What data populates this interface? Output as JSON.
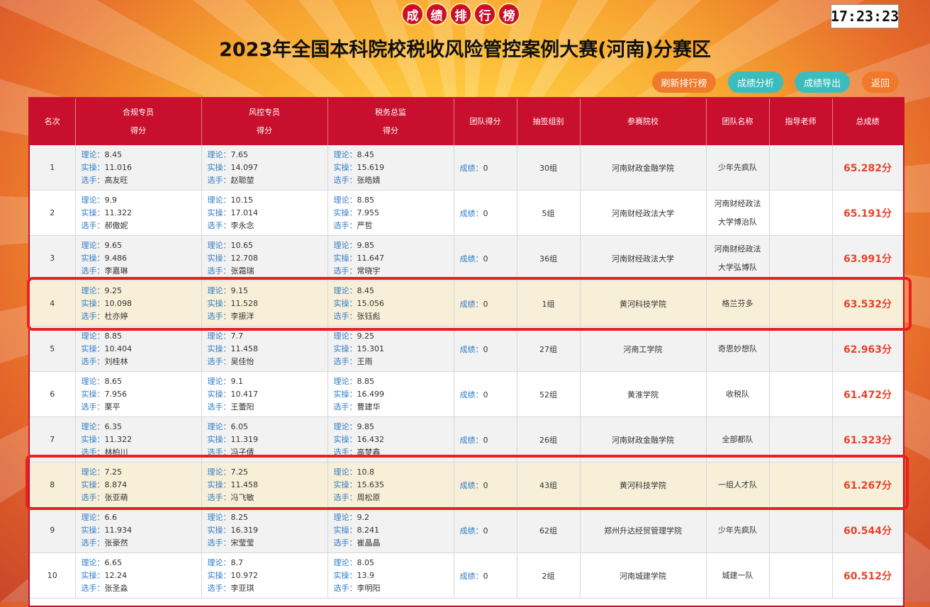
{
  "header": {
    "badge_chars": [
      "成",
      "绩",
      "排",
      "行",
      "榜"
    ],
    "clock": "17:23:23",
    "title": "2023年全国本科院校税收风险管控案例大赛(河南)分赛区"
  },
  "buttons": {
    "refresh": "刷新排行榜",
    "analysis": "成绩分析",
    "export": "成绩导出",
    "back": "返回"
  },
  "table": {
    "headers": {
      "rank": "名次",
      "compliance": "合规专员",
      "risk": "风控专员",
      "tax": "税务总监",
      "score_sub": "得分",
      "team_score": "团队得分",
      "group": "抽签组别",
      "school": "参赛院校",
      "team_name": "团队名称",
      "teacher": "指导老师",
      "total": "总成绩"
    },
    "labels": {
      "theory": "理论：",
      "practice": "实操：",
      "player": "选手：",
      "result": "成绩："
    },
    "rows": [
      {
        "rank": "1",
        "c": {
          "t": "8.45",
          "p": "11.016",
          "n": "高友旺"
        },
        "r": {
          "t": "7.65",
          "p": "14.097",
          "n": "赵聪堃"
        },
        "x": {
          "t": "8.45",
          "p": "15.619",
          "n": "张皓婧"
        },
        "team_score": "0",
        "group": "30组",
        "school": "河南财政金融学院",
        "team": "少年先疯队",
        "teacher": "",
        "total": "65.282分"
      },
      {
        "rank": "2",
        "c": {
          "t": "9.9",
          "p": "11.322",
          "n": "郝傲妮"
        },
        "r": {
          "t": "10.15",
          "p": "17.014",
          "n": "李永念"
        },
        "x": {
          "t": "8.85",
          "p": "7.955",
          "n": "严哲"
        },
        "team_score": "0",
        "group": "5组",
        "school": "河南财经政法大学",
        "team": "河南财经政法大学博治队",
        "teacher": "",
        "total": "65.191分"
      },
      {
        "rank": "3",
        "c": {
          "t": "9.65",
          "p": "9.486",
          "n": "李嘉琳"
        },
        "r": {
          "t": "10.65",
          "p": "12.708",
          "n": "张霜瑞"
        },
        "x": {
          "t": "9.85",
          "p": "11.647",
          "n": "常晓宇"
        },
        "team_score": "0",
        "group": "36组",
        "school": "河南财经政法大学",
        "team": "河南财经政法大学弘博队",
        "teacher": "",
        "total": "63.991分"
      },
      {
        "rank": "4",
        "c": {
          "t": "9.25",
          "p": "10.098",
          "n": "杜亦婷"
        },
        "r": {
          "t": "9.15",
          "p": "11.528",
          "n": "李振洋"
        },
        "x": {
          "t": "8.45",
          "p": "15.056",
          "n": "张钰彪"
        },
        "team_score": "0",
        "group": "1组",
        "school": "黄河科技学院",
        "team": "格兰芬多",
        "teacher": "",
        "total": "63.532分"
      },
      {
        "rank": "5",
        "c": {
          "t": "8.85",
          "p": "10.404",
          "n": "刘桂林"
        },
        "r": {
          "t": "7.7",
          "p": "11.458",
          "n": "吴佳怡"
        },
        "x": {
          "t": "9.25",
          "p": "15.301",
          "n": "王雨"
        },
        "team_score": "0",
        "group": "27组",
        "school": "河南工学院",
        "team": "奇思妙想队",
        "teacher": "",
        "total": "62.963分"
      },
      {
        "rank": "6",
        "c": {
          "t": "8.65",
          "p": "7.956",
          "n": "栗平"
        },
        "r": {
          "t": "9.1",
          "p": "10.417",
          "n": "王蕾阳"
        },
        "x": {
          "t": "8.85",
          "p": "16.499",
          "n": "曹建华"
        },
        "team_score": "0",
        "group": "52组",
        "school": "黄淮学院",
        "team": "收税队",
        "teacher": "",
        "total": "61.472分"
      },
      {
        "rank": "7",
        "c": {
          "t": "6.35",
          "p": "11.322",
          "n": "林柏川"
        },
        "r": {
          "t": "6.05",
          "p": "11.319",
          "n": "冯子倩"
        },
        "x": {
          "t": "9.85",
          "p": "16.432",
          "n": "高梦鑫"
        },
        "team_score": "0",
        "group": "26组",
        "school": "河南财政金融学院",
        "team": "全部都队",
        "teacher": "",
        "total": "61.323分"
      },
      {
        "rank": "8",
        "c": {
          "t": "7.25",
          "p": "8.874",
          "n": "张亚萌"
        },
        "r": {
          "t": "7.25",
          "p": "11.458",
          "n": "冯飞敏"
        },
        "x": {
          "t": "10.8",
          "p": "15.635",
          "n": "周松原"
        },
        "team_score": "0",
        "group": "43组",
        "school": "黄河科技学院",
        "team": "一组人才队",
        "teacher": "",
        "total": "61.267分"
      },
      {
        "rank": "9",
        "c": {
          "t": "6.6",
          "p": "11.934",
          "n": "张豪然"
        },
        "r": {
          "t": "8.25",
          "p": "16.319",
          "n": "宋莹莹"
        },
        "x": {
          "t": "9.2",
          "p": "8.241",
          "n": "崔晶晶"
        },
        "team_score": "0",
        "group": "62组",
        "school": "郑州升达经贸管理学院",
        "team": "少年先疯队",
        "teacher": "",
        "total": "60.544分"
      },
      {
        "rank": "10",
        "c": {
          "t": "6.65",
          "p": "12.24",
          "n": "张圣淼"
        },
        "r": {
          "t": "8.7",
          "p": "10.972",
          "n": "李亚琪"
        },
        "x": {
          "t": "8.05",
          "p": "13.9",
          "n": "李明阳"
        },
        "team_score": "0",
        "group": "2组",
        "school": "河南城建学院",
        "team": "城建一队",
        "teacher": "",
        "total": "60.512分"
      }
    ],
    "highlighted_ranks": [
      "4",
      "8"
    ]
  },
  "colors": {
    "header_red": "#c8102e",
    "total_red": "#e8432a",
    "label_blue": "#2f7dc6",
    "btn_orange": "#f07a2c",
    "btn_teal": "#3cbdbd",
    "annotation_red": "#e82020"
  }
}
